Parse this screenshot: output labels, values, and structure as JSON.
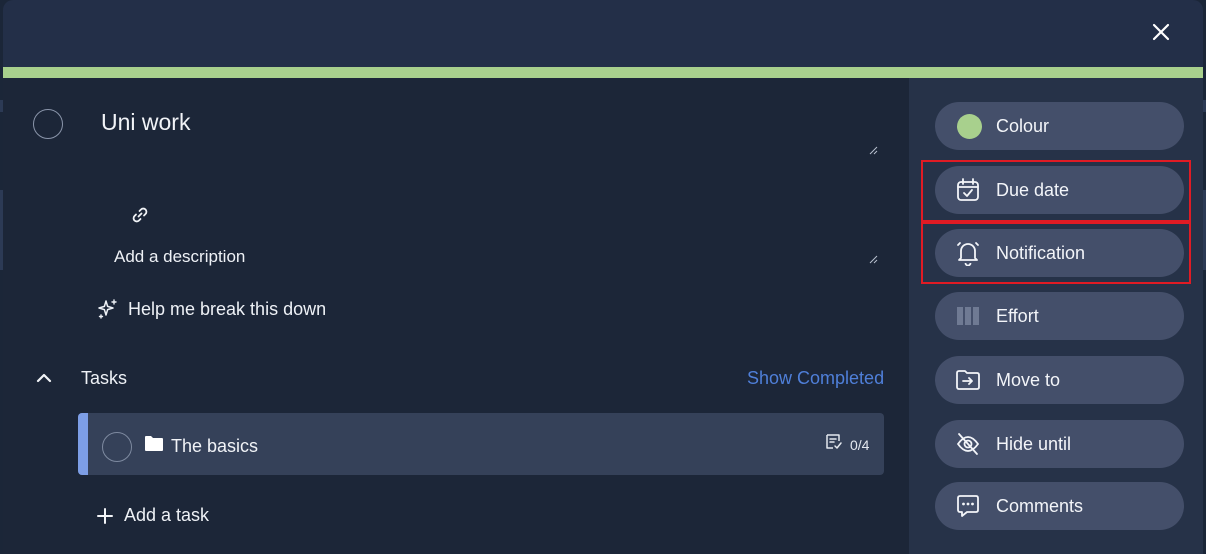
{
  "task": {
    "title": "Uni work",
    "description_placeholder": "Add a description",
    "help_label": "Help me break this down"
  },
  "tasks_section": {
    "title": "Tasks",
    "show_completed_label": "Show Completed",
    "items": [
      {
        "label": "The basics",
        "subtask_count": "0/4"
      }
    ],
    "add_task_label": "Add a task"
  },
  "sidebar": {
    "colour_label": "Colour",
    "due_date_label": "Due date",
    "notification_label": "Notification",
    "effort_label": "Effort",
    "move_to_label": "Move to",
    "hide_until_label": "Hide until",
    "comments_label": "Comments"
  },
  "colors": {
    "accent": "#a8d08d",
    "task_accent": "#7d9ee6",
    "link": "#4f7fd9",
    "highlight": "#e01b24"
  },
  "icons": [
    "close-icon",
    "link-icon",
    "sparkle-icon",
    "chevron-up-icon",
    "folder-icon",
    "subtask-list-icon",
    "plus-icon",
    "calendar-icon",
    "bell-icon",
    "effort-bars-icon",
    "folder-move-icon",
    "eye-off-icon",
    "comment-icon"
  ]
}
